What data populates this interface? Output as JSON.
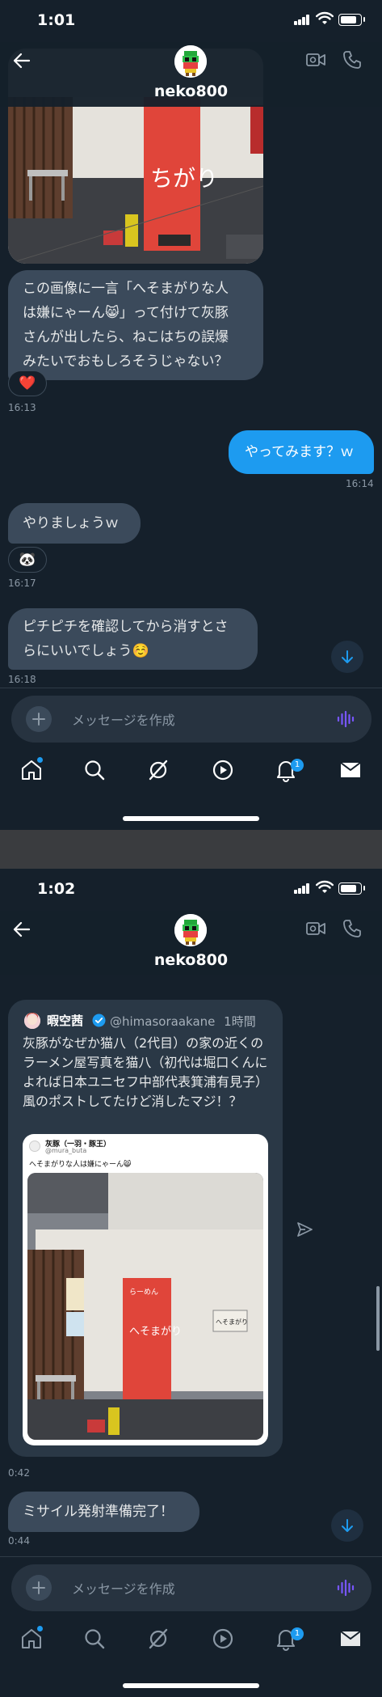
{
  "screen1": {
    "status_time": "1:01",
    "contact_name": "neko800",
    "messages": {
      "m1_lines": [
        "この画像に一言「へそまがりな人",
        "は嫌にゃーん😸」って付けて灰豚",
        "さんが出したら、ねこはちの誤爆",
        "みたいでおもしろそうじゃない？"
      ],
      "m1_reaction": "❤️",
      "m1_time": "16:13",
      "m2_text": "やってみます？ｗ",
      "m2_time": "16:14",
      "m3_text": "やりましょうｗ",
      "m3_reaction": "🐼",
      "m3_time": "16:17",
      "m4_lines": [
        "ピチピチを確認してから消すとさ",
        "らにいいでしょう☺️"
      ],
      "m4_time": "16:18"
    },
    "composer_placeholder": "メッセージを作成",
    "notifications_badge": "1",
    "photo_banner_text": "ちがり"
  },
  "screen2": {
    "status_time": "1:02",
    "contact_name": "neko800",
    "quote": {
      "author_name": "暇空茜",
      "author_handle": "@himasoraakane",
      "age": "1時間",
      "text": "灰豚がなぜか猫八（2代目）の家の近くのラーメン屋写真を猫八（初代は堀口くんによれば日本ユニセフ中部代表箕浦有見子）風のポストしてたけど消したマジ！？",
      "card_name": "灰豚（一羽・豚王）",
      "card_handle": "@mura_buta",
      "card_text": "へそまがりな人は嫌にゃーん😸",
      "banner_small": "らーめん",
      "banner_big": "へそまがり",
      "sign_text": "へそまがり"
    },
    "quote_time": "0:42",
    "m5_text": "ミサイル発射準備完了！",
    "m5_time": "0:44",
    "composer_placeholder": "メッセージを作成",
    "notifications_badge": "1"
  },
  "colors": {
    "background": "#15202b",
    "accent": "#1d9bf0",
    "incoming_bubble": "#3b4a5b",
    "composer": "#273340"
  }
}
